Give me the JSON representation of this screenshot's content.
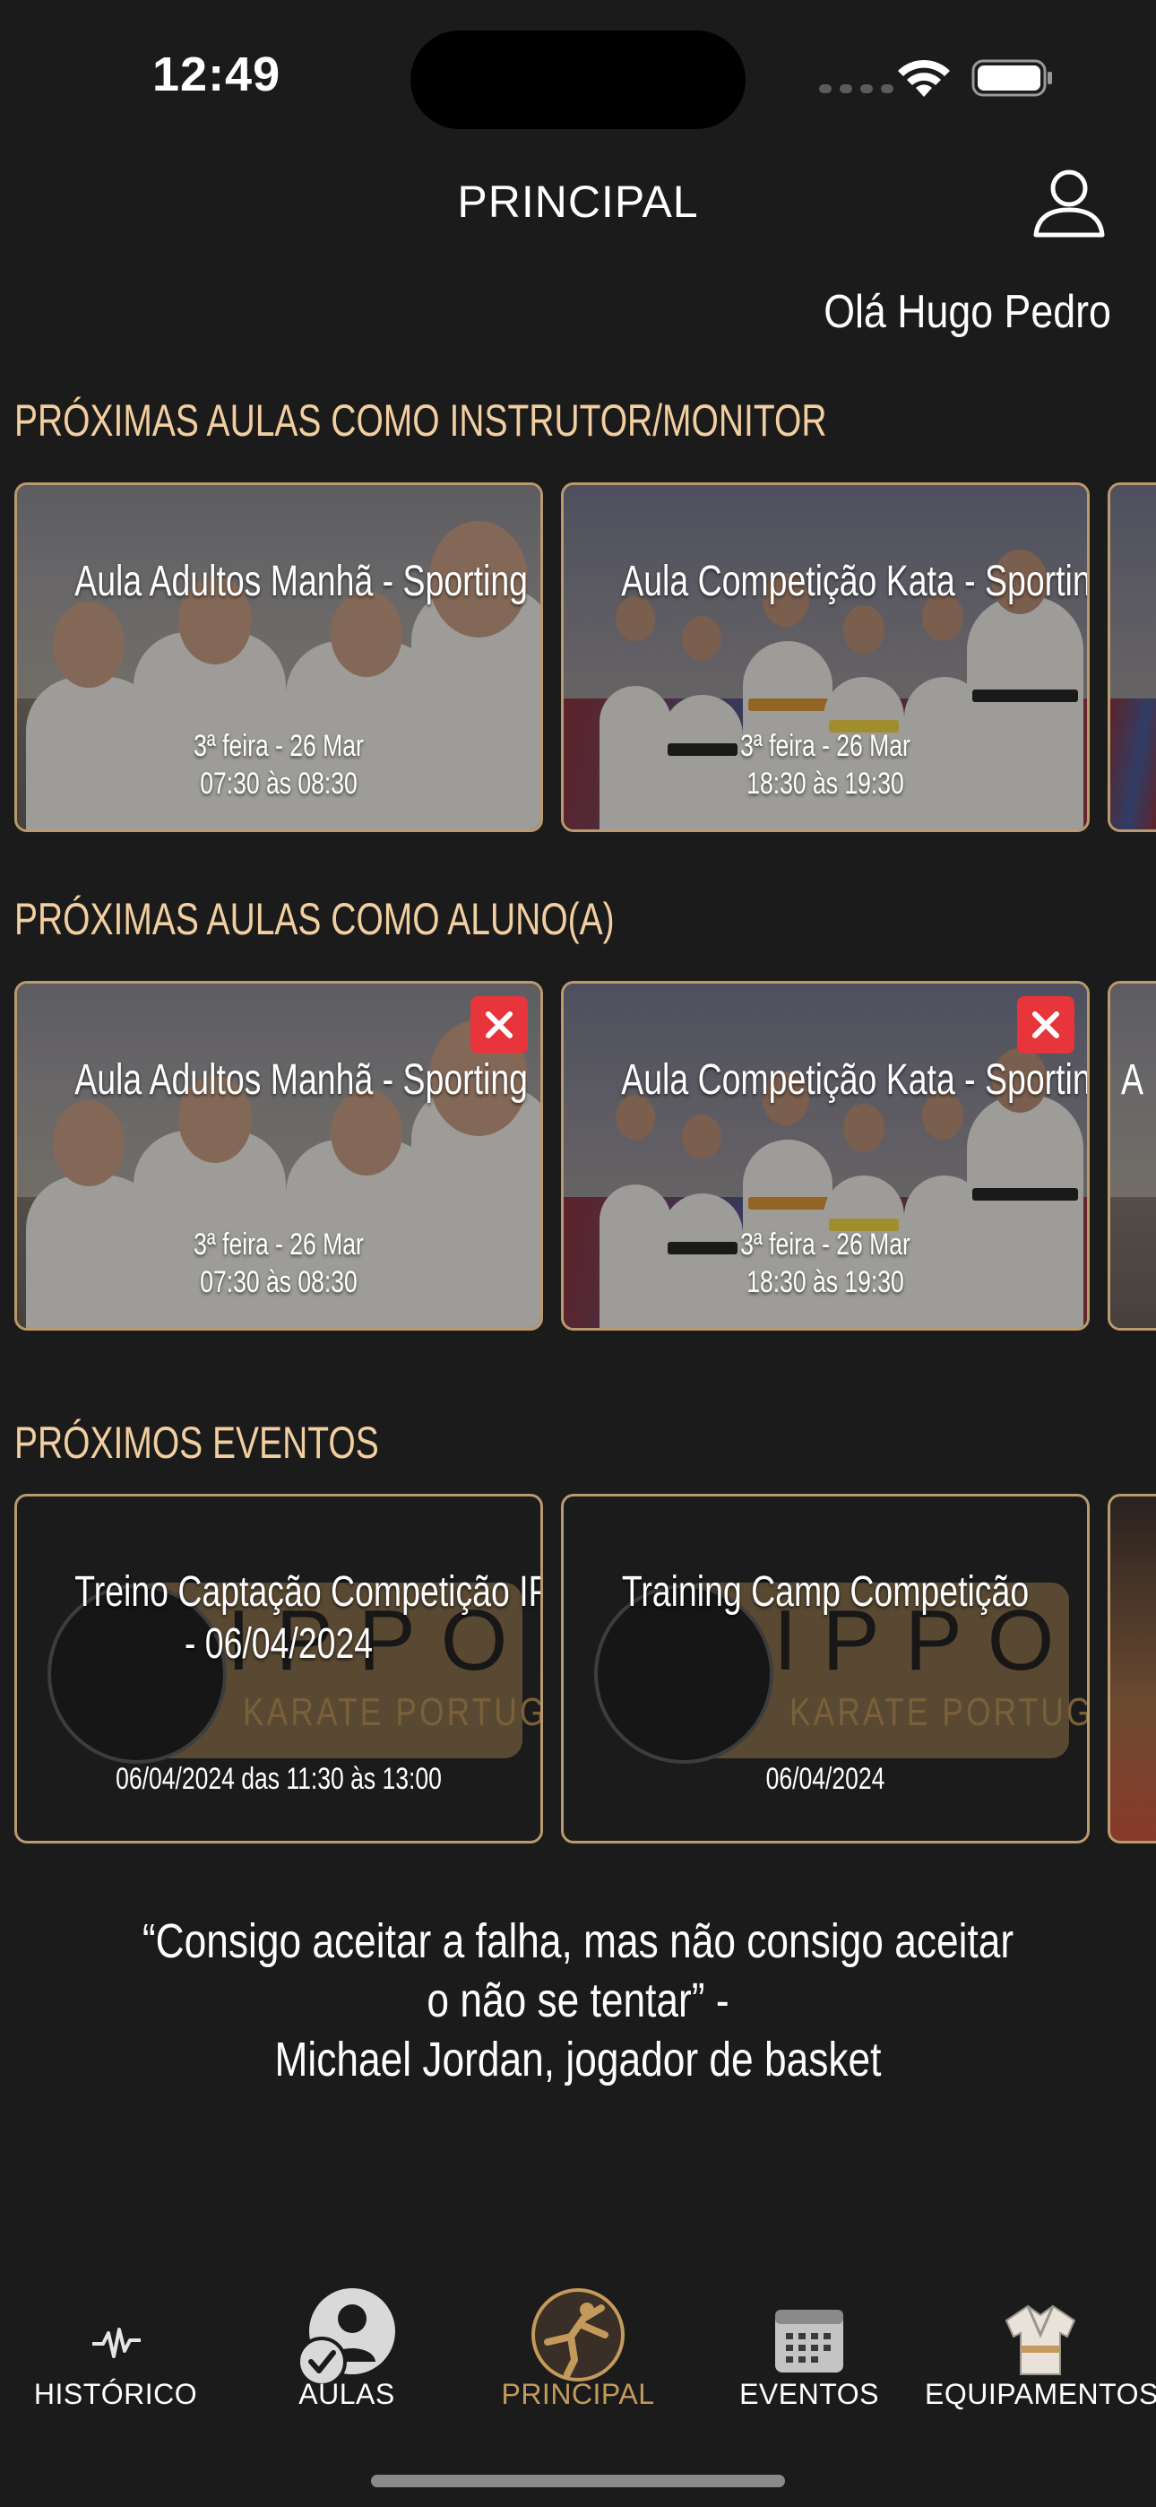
{
  "status_bar": {
    "time": "12:49"
  },
  "header": {
    "title": "PRINCIPAL",
    "greeting": "Olá Hugo Pedro"
  },
  "sections": {
    "instructor": {
      "title": "PRÓXIMAS AULAS COMO INSTRUTOR/MONITOR",
      "classes": [
        {
          "title": "Aula Adultos Manhã - Sporting",
          "date": "3ª feira - 26 Mar",
          "time": "07:30 às 08:30"
        },
        {
          "title": "Aula Competição Kata - Sporting",
          "date": "3ª feira - 26 Mar",
          "time": "18:30 às 19:30"
        }
      ]
    },
    "student": {
      "title": "PRÓXIMAS AULAS COMO ALUNO(A)",
      "classes": [
        {
          "title": "Aula Adultos Manhã - Sporting",
          "date": "3ª feira - 26 Mar",
          "time": "07:30 às 08:30"
        },
        {
          "title": "Aula Competição Kata - Sporting",
          "date": "3ª feira - 26 Mar",
          "time": "18:30 às 19:30"
        }
      ],
      "peek_letter": "A"
    },
    "events": {
      "title": "PRÓXIMOS EVENTOS",
      "items": [
        {
          "title_line1": "Treino Captação Competição IPPON",
          "title_line2": "- 06/04/2024",
          "date": "06/04/2024 das 11:30 às 13:00"
        },
        {
          "title_line1": "Training Camp Competição",
          "title_line2": "",
          "date": "06/04/2024"
        }
      ],
      "logo_text": "IPPON",
      "logo_subtext": "KARATE PORTUGAL"
    }
  },
  "quote": {
    "line1": "“Consigo aceitar a falha, mas não consigo aceitar o não se tentar” -",
    "line2": "Michael Jordan, jogador de basket"
  },
  "tab_bar": {
    "tabs": [
      {
        "label": "HISTÓRICO",
        "icon": "pulse-icon"
      },
      {
        "label": "AULAS",
        "icon": "classes-icon"
      },
      {
        "label": "PRINCIPAL",
        "icon": "karate-kick-icon",
        "active": true
      },
      {
        "label": "EVENTOS",
        "icon": "calendar-icon"
      },
      {
        "label": "EQUIPAMENTOS",
        "icon": "kimono-icon"
      }
    ],
    "active_color": "#c49a5c"
  },
  "colors": {
    "background": "#1c1b1b",
    "accent": "#f2cfa0",
    "card_border": "#b89a6c",
    "cancel": "#e8343b"
  }
}
